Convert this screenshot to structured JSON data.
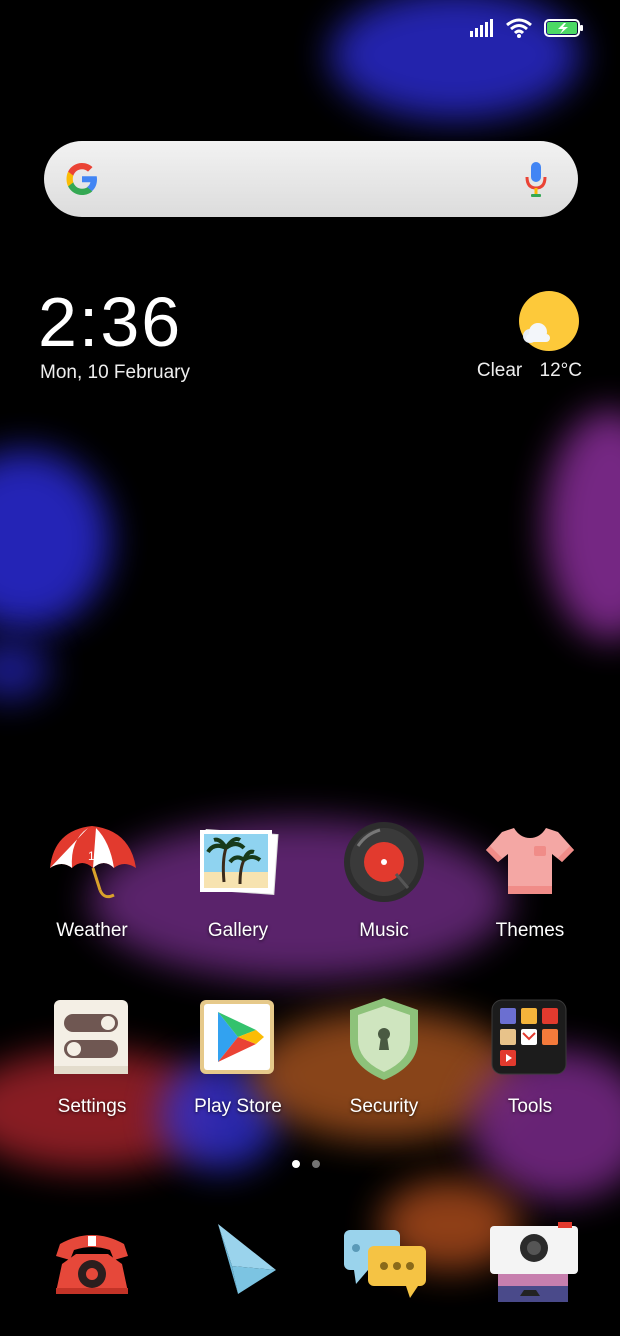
{
  "status": {
    "signal_icon": "signal-icon",
    "wifi_icon": "wifi-icon",
    "battery_icon": "battery-charging-icon"
  },
  "search": {
    "placeholder": ""
  },
  "clock": {
    "time": "2:36",
    "date": "Mon, 10 February"
  },
  "weather": {
    "condition": "Clear",
    "temp": "12°C"
  },
  "apps_row1": [
    {
      "label": "Weather"
    },
    {
      "label": "Gallery"
    },
    {
      "label": "Music"
    },
    {
      "label": "Themes"
    }
  ],
  "apps_row2": [
    {
      "label": "Settings"
    },
    {
      "label": "Play Store"
    },
    {
      "label": "Security"
    },
    {
      "label": "Tools"
    }
  ],
  "weather_icon_temp": "12°",
  "page_indicator": {
    "pages": 2,
    "current": 1
  },
  "dock": [
    {
      "icon": "phone-icon"
    },
    {
      "icon": "paper-plane-icon"
    },
    {
      "icon": "messaging-icon"
    },
    {
      "icon": "camera-icon"
    }
  ]
}
